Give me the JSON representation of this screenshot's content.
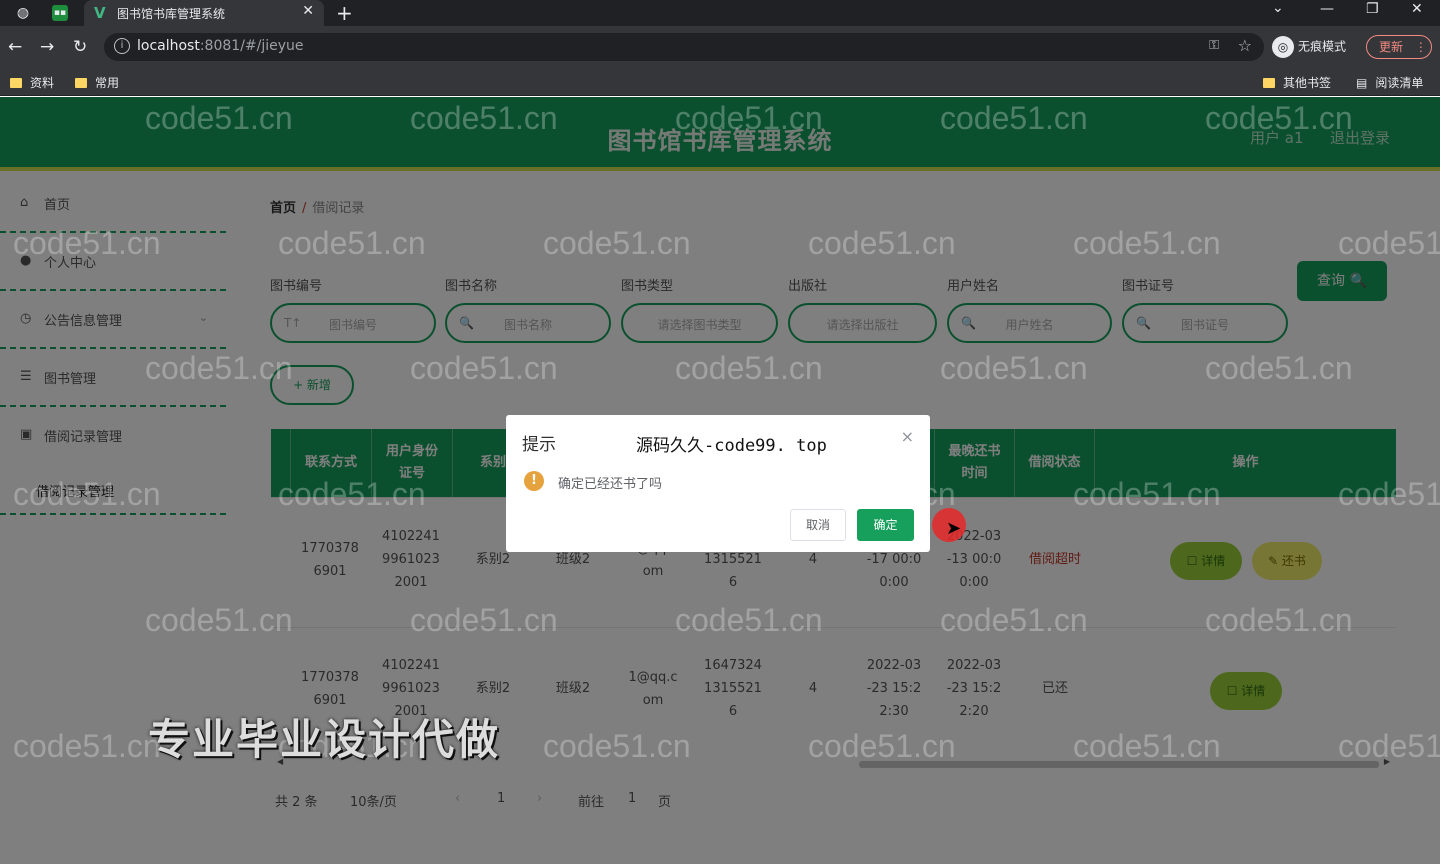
{
  "browser": {
    "tab_title": "图书馆书库管理系统",
    "tab_favicon": "V",
    "url_host": "localhost",
    "url_rest": ":8081/#/jieyue",
    "incognito_label": "无痕模式",
    "update_label": "更新",
    "bookmarks": [
      "资料",
      "常用"
    ],
    "bookmarks_right": [
      "其他书签",
      "阅读清单"
    ]
  },
  "header": {
    "title": "图书馆书库管理系统",
    "user": "用户 a1",
    "logout": "退出登录"
  },
  "sidebar": {
    "items": [
      {
        "label": "首页",
        "icon": "home-icon"
      },
      {
        "label": "个人中心",
        "icon": "user-icon"
      },
      {
        "label": "公告信息管理",
        "icon": "notice-icon"
      },
      {
        "label": "图书管理",
        "icon": "list-icon"
      },
      {
        "label": "借阅记录管理",
        "icon": "record-icon"
      }
    ],
    "sub_item": "借阅记录管理"
  },
  "breadcrumb": {
    "home": "首页",
    "sep": "/",
    "current": "借阅记录"
  },
  "filters": [
    {
      "label": "图书编号",
      "placeholder": "图书编号",
      "prefix": "T↑"
    },
    {
      "label": "图书名称",
      "placeholder": "图书名称",
      "prefix": "🔍"
    },
    {
      "label": "图书类型",
      "placeholder": "请选择图书类型",
      "prefix": ""
    },
    {
      "label": "出版社",
      "placeholder": "请选择出版社",
      "prefix": ""
    },
    {
      "label": "用户姓名",
      "placeholder": "用户姓名",
      "prefix": "🔍"
    },
    {
      "label": "图书证号",
      "placeholder": "图书证号",
      "prefix": "🔍"
    }
  ],
  "buttons": {
    "query": "查询 🔍",
    "add": "+ 新增"
  },
  "table": {
    "headers": [
      "联系方式",
      "用户身份证号",
      "系别",
      "最晚还书时间",
      "借阅状态",
      "操作"
    ],
    "rows": [
      {
        "phone": [
          "1770378",
          "6901"
        ],
        "idcard": [
          "4102241",
          "9961023",
          "2001"
        ],
        "dept": "系别2",
        "cls": "班级2",
        "email": [
          "1@qq.c",
          "om"
        ],
        "card": [
          "1315521",
          "6"
        ],
        "num": "4",
        "borrow": [
          "2022-03",
          "-17 00:0",
          "0:00"
        ],
        "due": [
          "2022-03",
          "-13 00:0",
          "0:00"
        ],
        "status": "借阅超时",
        "actions": [
          "☐ 详情",
          "✎ 还书"
        ]
      },
      {
        "phone": [
          "1770378",
          "6901"
        ],
        "idcard": [
          "4102241",
          "9961023",
          "2001"
        ],
        "dept": "系别2",
        "cls": "班级2",
        "email": [
          "1@qq.c",
          "om"
        ],
        "card": [
          "1647324",
          "1315521",
          "6"
        ],
        "num": "4",
        "borrow": [
          "2022-03",
          "-23 15:2",
          "2:30"
        ],
        "due": [
          "2022-03",
          "-23 15:2",
          "2:20"
        ],
        "status": "已还",
        "actions": [
          "☐ 详情"
        ]
      }
    ]
  },
  "pagination": {
    "total": "共 2 条",
    "page_size": "10条/页",
    "current": "1",
    "goto": "前往",
    "goto_page": "1",
    "page_unit": "页"
  },
  "dialog": {
    "title": "提示",
    "message": "确定已经还书了吗",
    "cancel": "取消",
    "confirm": "确定",
    "close": "×"
  },
  "overlay": {
    "site_text": "源码久久-code99. top",
    "promo_text": "专业毕业设计代做",
    "watermark": "code51.cn"
  },
  "colors": {
    "primary": "#17a05c",
    "accent": "#d3e04e",
    "detail": "#9bd03a",
    "return": "#f0ec6a",
    "warning": "#e6a23c"
  }
}
